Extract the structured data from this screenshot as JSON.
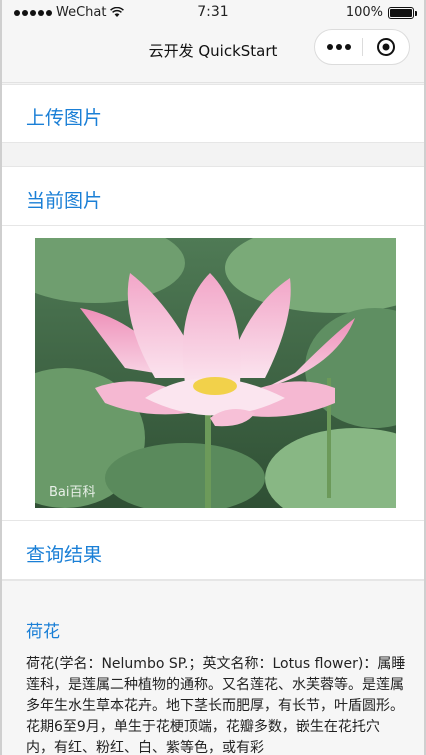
{
  "status_bar": {
    "carrier": "WeChat",
    "time": "7:31",
    "battery": "100%",
    "battery_level": 1.0
  },
  "navbar": {
    "title": "云开发 QuickStart"
  },
  "sections": {
    "upload_label": "上传图片",
    "current_label": "当前图片",
    "query_label": "查询结果"
  },
  "image": {
    "watermark": "Bai百科"
  },
  "result": {
    "name": "荷花",
    "description": "荷花(学名：Nelumbo SP.；英文名称：Lotus flower)：属睡莲科，是莲属二种植物的通称。又名莲花、水芙蓉等。是莲属多年生水生草本花卉。地下茎长而肥厚，有长节，叶盾圆形。花期6至9月，单生于花梗顶端，花瓣多数，嵌生在花托穴内，有红、粉红、白、紫等色，或有彩"
  },
  "icons": {
    "more": "more-icon",
    "close": "capsule-close-icon",
    "wifi": "wifi-icon",
    "battery": "battery-icon"
  },
  "colors": {
    "accent": "#1a7fd6",
    "background": "#f3f3f3"
  }
}
